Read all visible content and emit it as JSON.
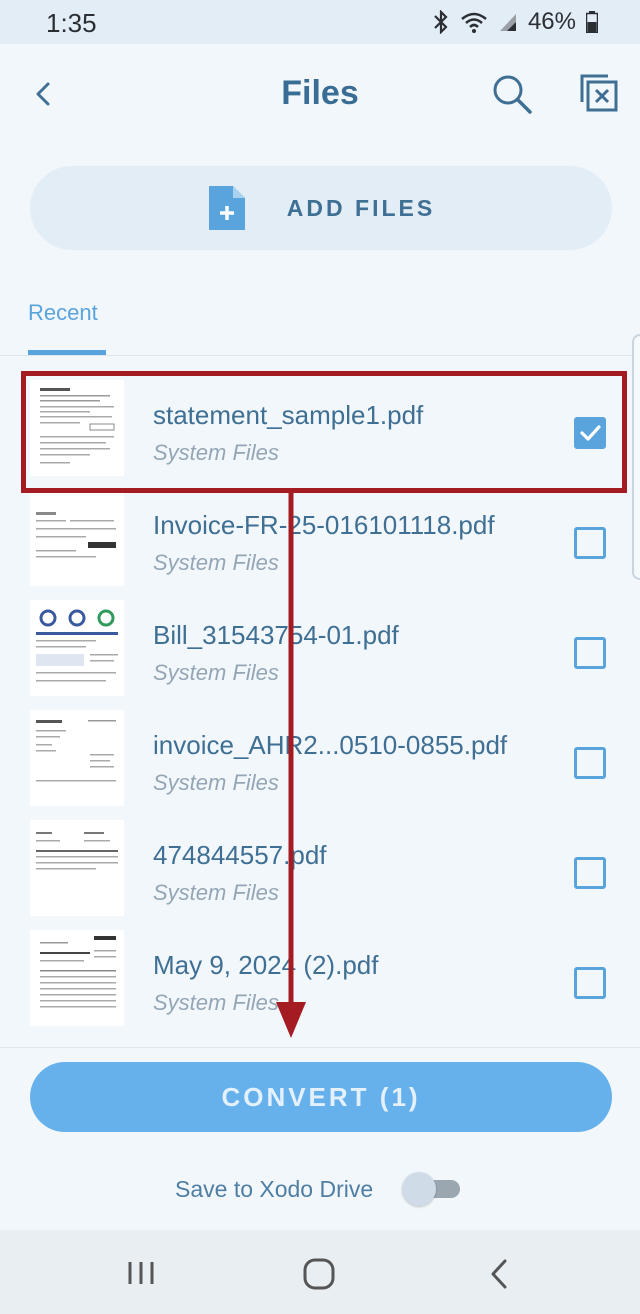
{
  "status_bar": {
    "time": "1:35",
    "battery": "46%",
    "icons": [
      "bluetooth-icon",
      "wifi-icon",
      "signal-icon",
      "battery-icon"
    ]
  },
  "header": {
    "title": "Files",
    "back_icon": "back-chevron-icon",
    "search_icon": "search-icon",
    "close_icon": "close-selection-icon"
  },
  "add_files": {
    "label": "ADD FILES",
    "icon": "add-file-icon"
  },
  "tabs": [
    {
      "label": "Recent",
      "selected": true
    }
  ],
  "files": [
    {
      "name": "statement_sample1.pdf",
      "location": "System Files",
      "checked": true
    },
    {
      "name": "Invoice-FR-25-016101118.pdf",
      "location": "System Files",
      "checked": false
    },
    {
      "name": "Bill_31543754-01.pdf",
      "location": "System Files",
      "checked": false
    },
    {
      "name": "invoice_AHR2...0510-0855.pdf",
      "location": "System Files",
      "checked": false
    },
    {
      "name": "474844557.pdf",
      "location": "System Files",
      "checked": false
    },
    {
      "name": "May 9, 2024 (2).pdf",
      "location": "System Files",
      "checked": false
    }
  ],
  "convert": {
    "label": "CONVERT (1)"
  },
  "save_drive": {
    "label": "Save to Xodo Drive",
    "enabled": false
  },
  "colors": {
    "accent": "#5aa4dd",
    "button": "#66b1ec",
    "annotation": "#a41c22",
    "background": "#f2f7fc"
  },
  "nav_bar": {
    "icons": [
      "recent-apps-icon",
      "home-icon",
      "back-icon"
    ]
  }
}
